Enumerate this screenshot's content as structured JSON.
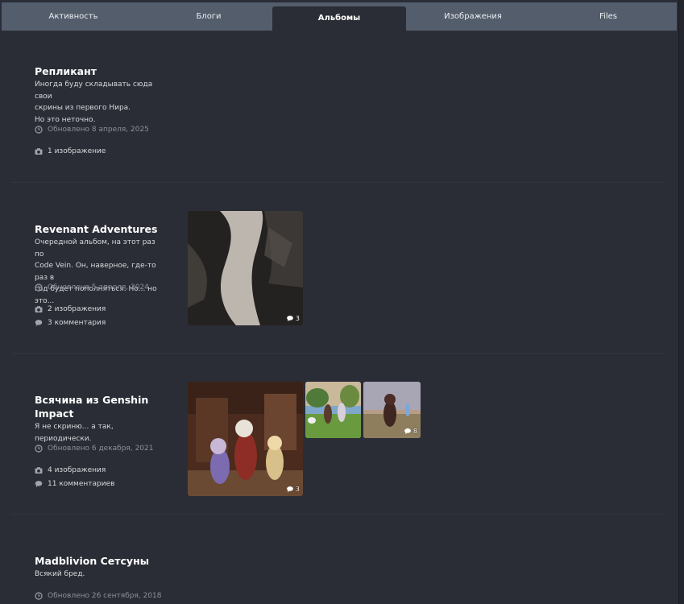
{
  "tabs": [
    {
      "label": "Активность"
    },
    {
      "label": "Блоги"
    },
    {
      "label": "Альбомы"
    },
    {
      "label": "Изображения"
    },
    {
      "label": "Files"
    }
  ],
  "active_tab": "Альбомы",
  "albums": [
    {
      "title": "Репликант",
      "description_lines": [
        "Иногда буду складывать сюда свои",
        "скрины из первого Нира.",
        "Но это неточно."
      ],
      "updated": "Обновлено 8 апреля, 2025",
      "images": "1 изображение",
      "comments": ""
    },
    {
      "title": "Revenant Adventures",
      "description_lines": [
        "Очередной альбом, на этот раз по",
        "Code Vein. Он, наверное, где-то раз в",
        "год будет пополняться. Но... но это..."
      ],
      "updated": "Обновлено 5 апреля, 2024",
      "images": "2 изображения",
      "comments": "3 комментария",
      "thumb_counts": [
        "3"
      ]
    },
    {
      "title_lines": [
        "Всячина из Genshin",
        "Impact"
      ],
      "description_lines": [
        "Я не скриню... а так, периодически."
      ],
      "updated": "Обновлено 6 декабря, 2021",
      "images": "4 изображения",
      "comments": "11 комментариев",
      "thumb_counts": [
        "3",
        "",
        "8"
      ]
    },
    {
      "title": "Madblivion Сетсуны",
      "description_lines": [
        "Всякий бред."
      ],
      "updated": "Обновлено 26 сентября, 2018"
    }
  ],
  "icons": {
    "clock": "clock-icon",
    "camera": "camera-icon",
    "comment": "comment-icon"
  },
  "colors": {
    "background": "#2a2d35",
    "tabbar": "#535d6c",
    "text": "#ffffff",
    "muted": "#8b9099"
  }
}
